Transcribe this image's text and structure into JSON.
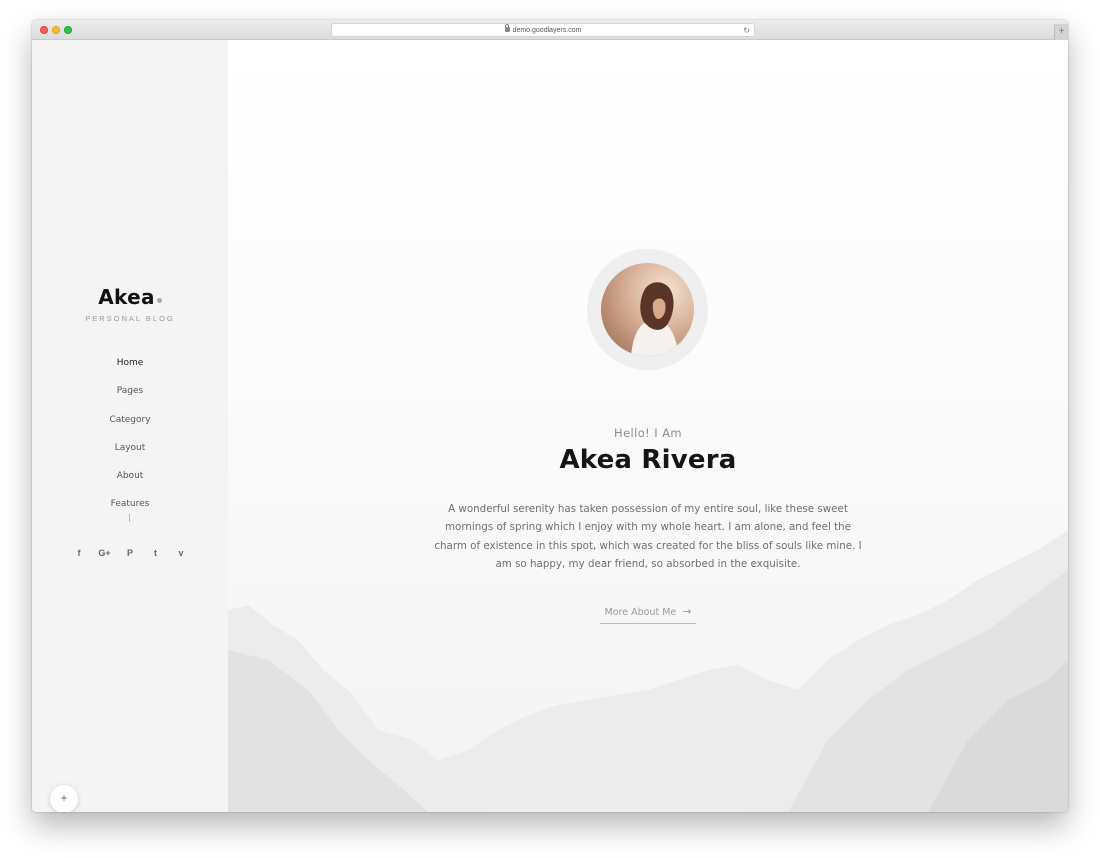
{
  "browser": {
    "url": "demo.goodlayers.com",
    "new_tab_label": "+"
  },
  "site": {
    "logo_text": "Akea",
    "tagline": "PERSONAL BLOG"
  },
  "nav": {
    "items": [
      {
        "label": "Home"
      },
      {
        "label": "Pages"
      },
      {
        "label": "Category"
      },
      {
        "label": "Layout"
      },
      {
        "label": "About"
      },
      {
        "label": "Features"
      }
    ]
  },
  "socials": {
    "icons": [
      "facebook-icon",
      "google-plus-icon",
      "pinterest-icon",
      "twitter-icon",
      "vimeo-icon"
    ],
    "glyphs": [
      "f",
      "G+",
      "P",
      "t",
      "v"
    ]
  },
  "fab": {
    "label": "+"
  },
  "hero": {
    "greeting": "Hello! I Am",
    "name": "Akea Rivera",
    "bio": "A wonderful serenity has taken possession of my entire soul, like these sweet mornings of spring which I enjoy with my whole heart. I am alone, and feel the charm of existence in this spot, which was created for the bliss of souls like mine. I am so happy, my dear friend, so absorbed in the exquisite.",
    "cta_label": "More About Me",
    "cta_arrow": "→"
  },
  "colors": {
    "sidebar_bg": "#f4f4f4",
    "divider_accent": "#e5a0a4",
    "heading": "#151515"
  }
}
